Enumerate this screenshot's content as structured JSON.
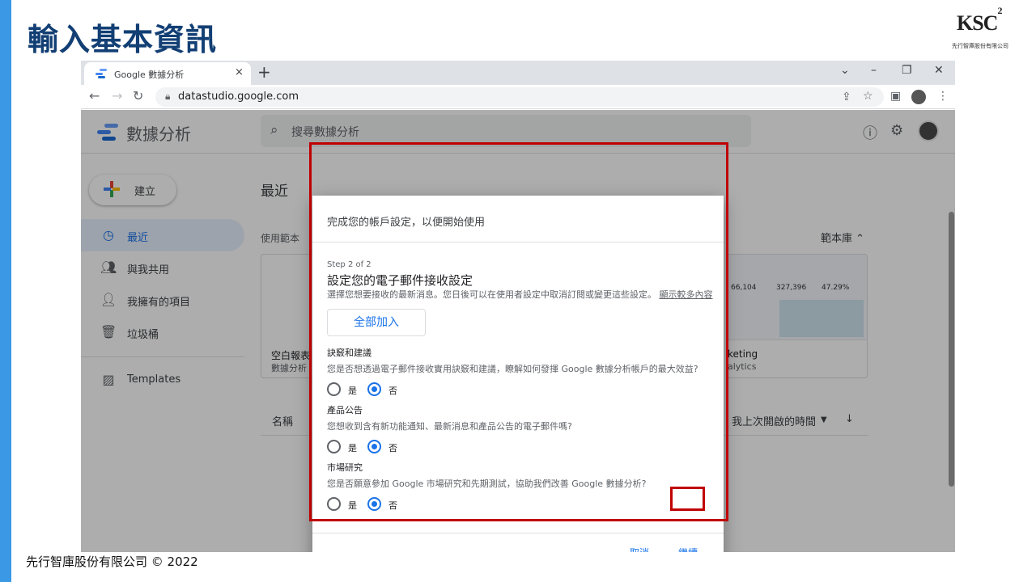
{
  "slide": {
    "title": "輸入基本資訊",
    "logo_text": "KSC",
    "logo_superscript": "2",
    "logo_company": "先行智庫股份有限公司",
    "footer": "先行智庫股份有限公司 © 2022",
    "accent_color": "#3b98e5",
    "title_color": "#123f74",
    "highlight_color": "#c00000"
  },
  "browser": {
    "tab_title": "Google 數據分析",
    "tab_close": "×",
    "new_tab": "+",
    "window_controls": [
      "⌄",
      "–",
      "❐",
      "✕"
    ],
    "url": "datastudio.google.com",
    "nav_icons": [
      "back-icon",
      "forward-icon",
      "reload-icon"
    ],
    "toolbar_icons": [
      "share-icon",
      "star-icon",
      "sidepanel-icon",
      "profile-icon",
      "menu-icon"
    ]
  },
  "app": {
    "name": "數據分析",
    "search_placeholder": "搜尋數據分析",
    "create_label": "建立",
    "sidebar": [
      {
        "label": "最近",
        "icon": "clock-icon",
        "active": true
      },
      {
        "label": "與我共用",
        "icon": "people-icon",
        "active": false
      },
      {
        "label": "我擁有的項目",
        "icon": "person-icon",
        "active": false
      },
      {
        "label": "垃圾桶",
        "icon": "trash-icon",
        "active": false
      },
      {
        "label": "Templates",
        "icon": "templates-icon",
        "active": false
      }
    ],
    "section_title": "最近",
    "gallery_label": "使用範本",
    "library_label": "範本庫 ⌃",
    "cards": [
      {
        "title": "空白報表",
        "sub": "數據分析"
      },
      {
        "title": "keting",
        "sub": "alytics"
      }
    ],
    "list_headers": {
      "name": "名稱",
      "last_opened": "我上次開啟的時間"
    },
    "thumb_values": [
      "66,104",
      "327,396",
      "47.29%"
    ]
  },
  "dialog": {
    "title": "完成您的帳戶設定，以便開始使用",
    "step": "Step 2 of 2",
    "heading": "設定您的電子郵件接收設定",
    "description": "選擇您想要接收的最新消息。您日後可以在使用者設定中取消訂閱或變更這些設定。",
    "learn_more": "顯示較多內容",
    "join_all": "全部加入",
    "questions": [
      {
        "title": "訣竅和建議",
        "desc": "您是否想透過電子郵件接收實用訣竅和建議，瞭解如何發揮 Google 數據分析帳戶的最大效益?",
        "yes": "是",
        "no": "否",
        "selected": "no"
      },
      {
        "title": "產品公告",
        "desc": "您想收到含有新功能通知、最新消息和產品公告的電子郵件嗎?",
        "yes": "是",
        "no": "否",
        "selected": "no"
      },
      {
        "title": "市場研究",
        "desc": "您是否願意參加 Google 市場研究和先期測試，協助我們改善 Google 數據分析?",
        "yes": "是",
        "no": "否",
        "selected": "no"
      }
    ],
    "cancel": "取消",
    "continue": "繼續"
  }
}
